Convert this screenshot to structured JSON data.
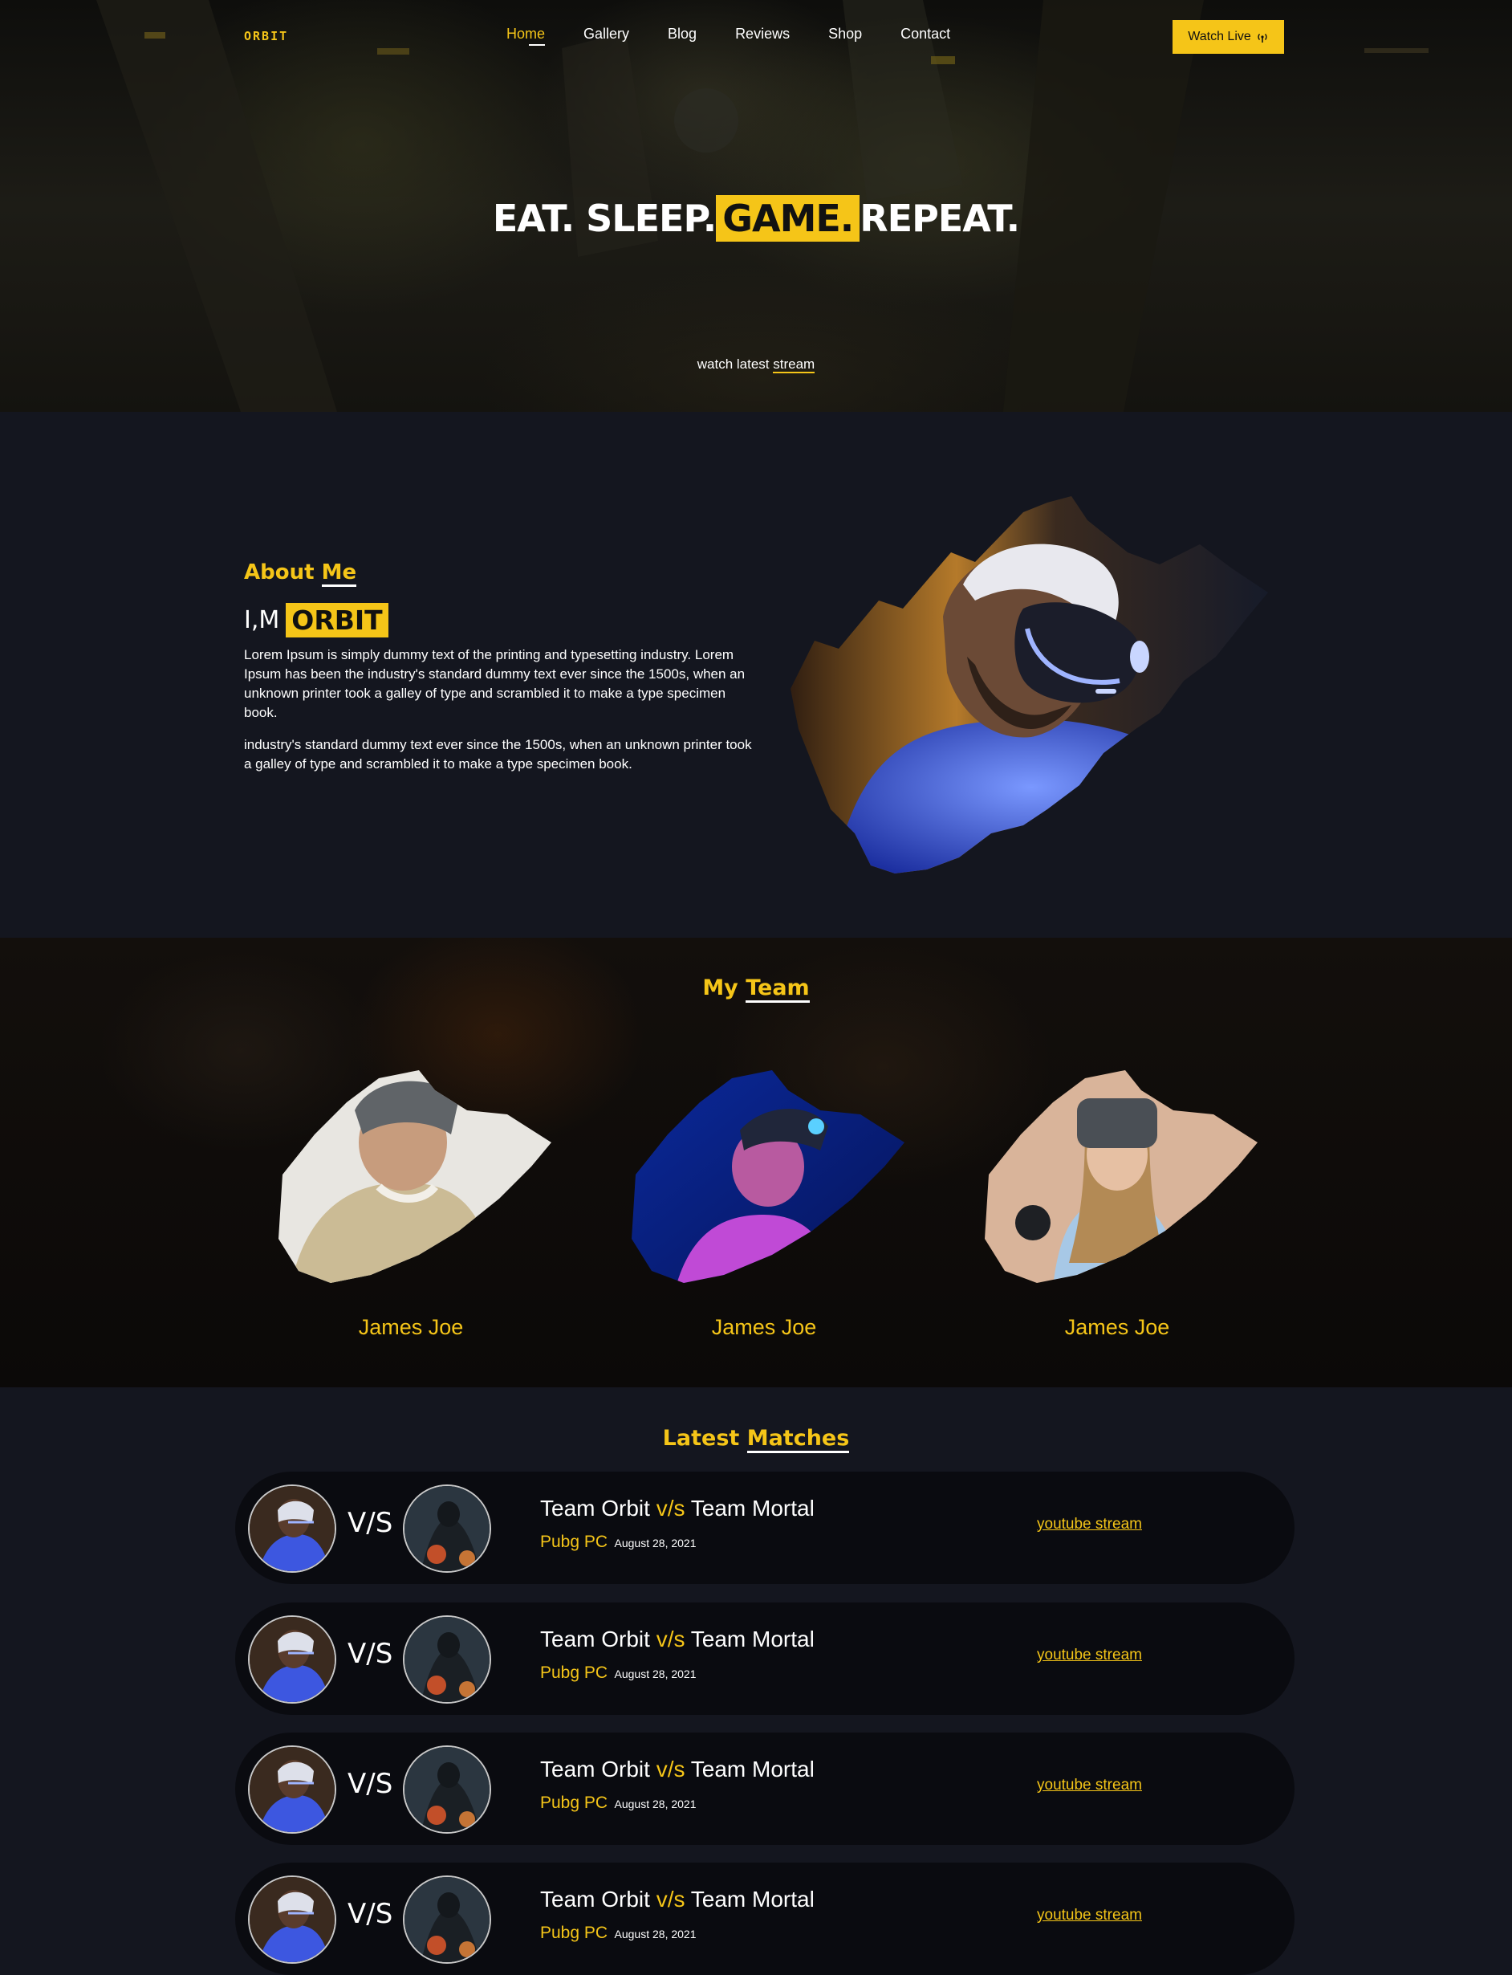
{
  "nav": {
    "logo": "ORBIT",
    "items": [
      "Home",
      "Gallery",
      "Blog",
      "Reviews",
      "Shop",
      "Contact"
    ],
    "active": "Home",
    "watch_live": "Watch Live",
    "watch_live_icon": "broadcast-icon"
  },
  "hero": {
    "title_before": "EAT. SLEEP.",
    "title_highlight": "GAME.",
    "title_after": "REPEAT.",
    "watch_text": "watch latest",
    "watch_link": "stream"
  },
  "about": {
    "heading_main": "About",
    "heading_accent": "Me",
    "intro_prefix": "I,M",
    "intro_name": "ORBIT",
    "paragraph_1": "Lorem Ipsum is simply dummy text of the printing and typesetting industry. Lorem Ipsum has been the industry's standard dummy text ever since the 1500s, when an unknown printer took a galley of type and scrambled it to make a type specimen book.",
    "paragraph_2": "industry's standard dummy text ever since the 1500s, when an unknown printer took a galley of type and scrambled it to make a type specimen book."
  },
  "team": {
    "heading_main": "My",
    "heading_accent": "Team",
    "members": [
      {
        "name": "James Joe"
      },
      {
        "name": "James Joe"
      },
      {
        "name": "James Joe"
      }
    ]
  },
  "matches": {
    "heading_main": "Latest",
    "heading_accent": "Matches",
    "items": [
      {
        "team_a": "Team Orbit",
        "vs": "v/s",
        "team_b": "Team Mortal",
        "vs_badge": "V/S",
        "game": "Pubg PC",
        "date": "August 28, 2021",
        "link": "youtube stream"
      },
      {
        "team_a": "Team Orbit",
        "vs": "v/s",
        "team_b": "Team Mortal",
        "vs_badge": "V/S",
        "game": "Pubg PC",
        "date": "August 28, 2021",
        "link": "youtube stream"
      },
      {
        "team_a": "Team Orbit",
        "vs": "v/s",
        "team_b": "Team Mortal",
        "vs_badge": "V/S",
        "game": "Pubg PC",
        "date": "August 28, 2021",
        "link": "youtube stream"
      },
      {
        "team_a": "Team Orbit",
        "vs": "v/s",
        "team_b": "Team Mortal",
        "vs_badge": "V/S",
        "game": "Pubg PC",
        "date": "August 28, 2021",
        "link": "youtube stream"
      }
    ]
  },
  "colors": {
    "accent": "#f5c518",
    "background": "#14161f",
    "card": "#0a0b10"
  }
}
